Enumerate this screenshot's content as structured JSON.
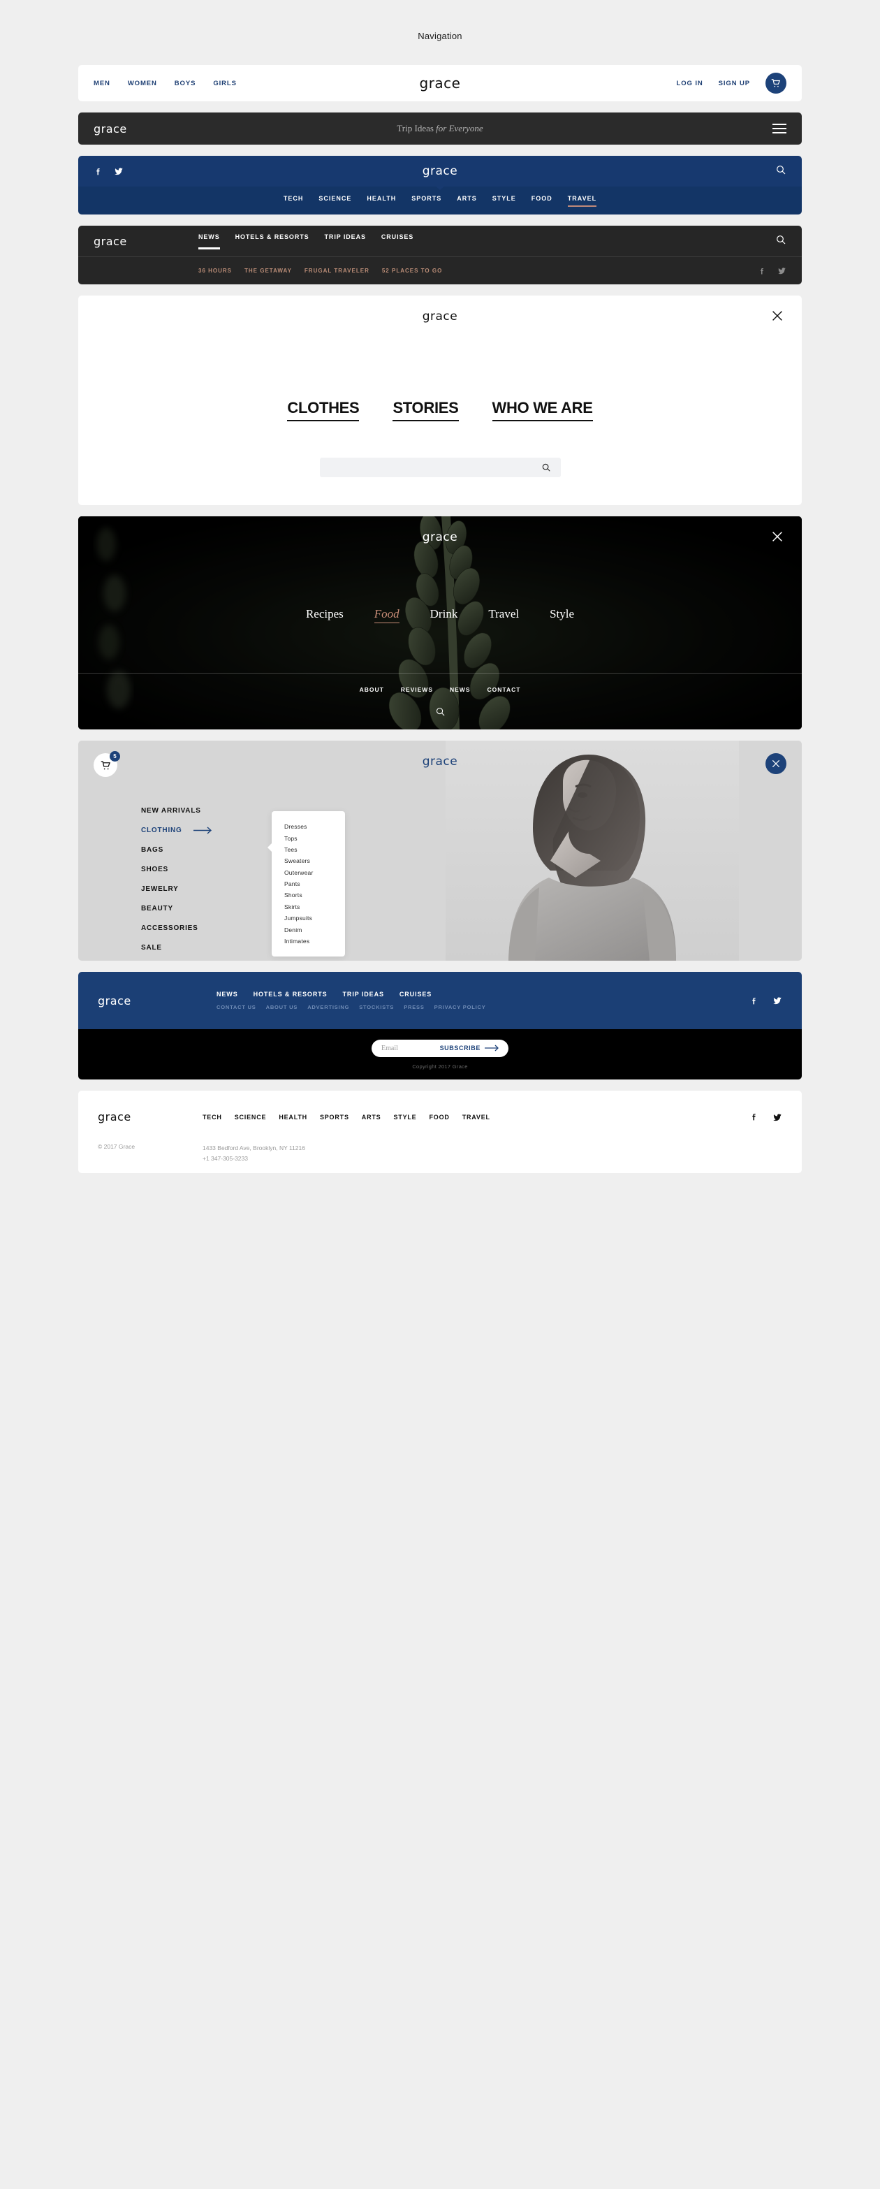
{
  "page": {
    "title": "Navigation"
  },
  "brand": {
    "name": "grace"
  },
  "colors": {
    "navy": "#1d4279",
    "blue_bar": "#17396f",
    "blue_bar_dark": "#133566",
    "dark": "#2b2b2b",
    "accent_tan": "#c0897a",
    "footer_blue": "#1b3f75"
  },
  "nav_shop": {
    "links": [
      "MEN",
      "WOMEN",
      "BOYS",
      "GIRLS"
    ],
    "brand": "grace",
    "login": "LOG IN",
    "signup": "SIGN UP",
    "cart_icon": "cart-icon"
  },
  "nav_trip": {
    "brand": "grace",
    "tagline_plain": "Trip Ideas ",
    "tagline_italic": "for Everyone",
    "menu_icon": "hamburger-icon"
  },
  "nav_magazine": {
    "brand": "grace",
    "social": [
      "facebook-icon",
      "twitter-icon"
    ],
    "search_icon": "search-icon",
    "categories": [
      "TECH",
      "SCIENCE",
      "HEALTH",
      "SPORTS",
      "ARTS",
      "STYLE",
      "FOOD",
      "TRAVEL"
    ],
    "active_category": "TRAVEL"
  },
  "nav_travel": {
    "brand": "grace",
    "links": [
      "NEWS",
      "HOTELS & RESORTS",
      "TRIP IDEAS",
      "CRUISES"
    ],
    "active_link": "NEWS",
    "search_icon": "search-icon",
    "sublinks": [
      "36 HOURS",
      "THE GETAWAY",
      "FRUGAL TRAVELER",
      "52 PLACES TO GO"
    ],
    "social": [
      "facebook-icon",
      "twitter-icon"
    ]
  },
  "overlay_white": {
    "brand": "grace",
    "close_icon": "close-icon",
    "links": [
      "CLOTHES",
      "STORIES",
      "WHO WE ARE"
    ],
    "search_placeholder": "",
    "search_icon": "search-icon"
  },
  "overlay_dark": {
    "brand": "grace",
    "close_icon": "close-icon",
    "menu": [
      "Recipes",
      "Food",
      "Drink",
      "Travel",
      "Style"
    ],
    "active": "Food",
    "sublinks": [
      "ABOUT",
      "REVIEWS",
      "NEWS",
      "CONTACT"
    ],
    "search_icon": "search-icon"
  },
  "overlay_shop": {
    "brand": "grace",
    "cart_icon": "cart-icon",
    "cart_count": "5",
    "close_icon": "close-icon",
    "menu": [
      "NEW ARRIVALS",
      "CLOTHING",
      "BAGS",
      "SHOES",
      "JEWELRY",
      "BEAUTY",
      "ACCESSORIES",
      "SALE"
    ],
    "active": "CLOTHING",
    "arrow_icon": "arrow-right-icon",
    "submenu": [
      "Dresses",
      "Tops",
      "Tees",
      "Sweaters",
      "Outerwear",
      "Pants",
      "Shorts",
      "Skirts",
      "Jumpsuits",
      "Denim",
      "Intimates"
    ]
  },
  "footer_blue": {
    "brand": "grace",
    "primary": [
      "NEWS",
      "HOTELS & RESORTS",
      "TRIP IDEAS",
      "CRUISES"
    ],
    "secondary": [
      "CONTACT US",
      "ABOUT US",
      "ADVERTISING",
      "STOCKISTS",
      "PRESS",
      "PRIVACY POLICY"
    ],
    "social": [
      "facebook-icon",
      "twitter-icon"
    ]
  },
  "subscribe": {
    "placeholder": "Email",
    "button": "SUBSCRIBE",
    "arrow_icon": "arrow-right-icon",
    "copyright": "Copyright 2017 Grace"
  },
  "footer_white": {
    "brand": "grace",
    "links": [
      "TECH",
      "SCIENCE",
      "HEALTH",
      "SPORTS",
      "ARTS",
      "STYLE",
      "FOOD",
      "TRAVEL"
    ],
    "social": [
      "facebook-icon",
      "twitter-icon"
    ],
    "copyright": "© 2017 Grace",
    "address": "1433 Bedford Ave, Brooklyn, NY 11216",
    "phone": "+1 347-305-3233"
  }
}
